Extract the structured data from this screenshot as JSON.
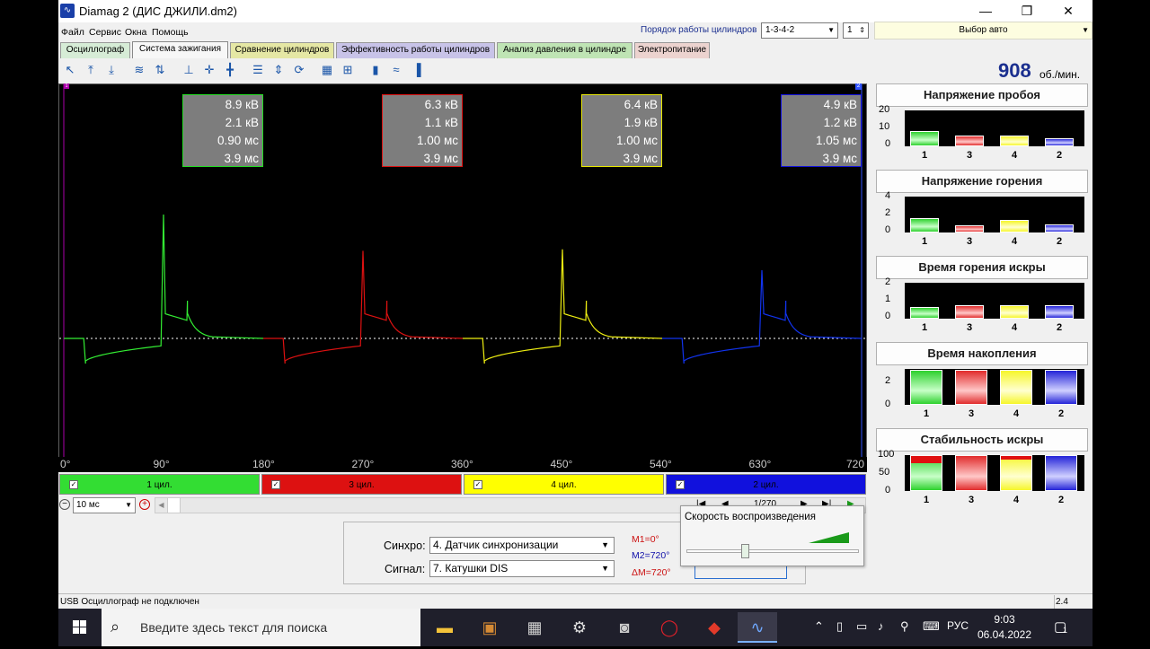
{
  "window": {
    "title": "Diamag 2 (ДИС ДЖИЛИ.dm2)",
    "min": "—",
    "max": "❐",
    "close": "✕"
  },
  "menu": [
    "Файл",
    "Сервис",
    "Окна",
    "Помощь"
  ],
  "header": {
    "order_label": "Порядок работы цилиндров",
    "order_value": "1-3-4-2",
    "cyl_count": "1",
    "auto_select": "Выбор авто"
  },
  "tabs": [
    {
      "label": "Осциллограф",
      "color": "#d6ecd6",
      "active": false
    },
    {
      "label": "Система зажигания",
      "color": "#f7f7f7",
      "active": true
    },
    {
      "label": "Сравнение цилиндров",
      "color": "#e5e7a4",
      "active": false
    },
    {
      "label": "Эффективность работы цилиндров",
      "color": "#c8c3e8",
      "active": false
    },
    {
      "label": "Анализ давления в цилиндре",
      "color": "#bfe4b4",
      "active": false
    },
    {
      "label": "Электропитание",
      "color": "#ecd3cf",
      "active": false
    }
  ],
  "rpm": {
    "value": "908",
    "unit": "об./мин."
  },
  "readouts": [
    {
      "values": [
        "8.9 кВ",
        "2.1 кВ",
        "0.90 мс",
        "3.9 мс"
      ],
      "color": "#22dd22"
    },
    {
      "values": [
        "6.3 кВ",
        "1.1 кВ",
        "1.00 мс",
        "3.9 мс"
      ],
      "color": "#dd1111"
    },
    {
      "values": [
        "6.4 кВ",
        "1.9 кВ",
        "1.00 мс",
        "3.9 мс"
      ],
      "color": "#e8e800"
    },
    {
      "values": [
        "4.9 кВ",
        "1.2 кВ",
        "1.05 мс",
        "3.9 мс"
      ],
      "color": "#1111dd"
    }
  ],
  "marker_left": "1",
  "marker_right": "2",
  "xaxis": [
    "0°",
    "90°",
    "180°",
    "270°",
    "360°",
    "450°",
    "540°",
    "630°",
    "720"
  ],
  "cylinders": [
    {
      "label": "1 цил.",
      "color": "#33dd33"
    },
    {
      "label": "3 цил.",
      "color": "#dd1111"
    },
    {
      "label": "4 цил.",
      "color": "#ffff00"
    },
    {
      "label": "2 цил.",
      "color": "#1111dd"
    }
  ],
  "timebase": "10 мс",
  "nav": {
    "page": "1/270"
  },
  "speed_popup": {
    "label": "Скорость воспроизведения",
    "level": 0.35
  },
  "sync": {
    "sync_label": "Синхро:",
    "sync_value": "4. Датчик синхронизации",
    "signal_label": "Сигнал:",
    "signal_value": "7. Катушки DIS",
    "m1": "M1=0°",
    "m2": "M2=720°",
    "dm": "ΔM=720°"
  },
  "status": {
    "text": "USB Осциллограф не подключен",
    "version": "2.4"
  },
  "panels": [
    {
      "title": "Напряжение пробоя",
      "ticks": [
        "20",
        "10",
        "0"
      ],
      "max": 20,
      "values": [
        8.9,
        6.3,
        6.4,
        4.9
      ],
      "cats": [
        "1",
        "3",
        "4",
        "2"
      ],
      "style": "small"
    },
    {
      "title": "Напряжение горения",
      "ticks": [
        "4",
        "2",
        "0"
      ],
      "max": 5,
      "values": [
        2.1,
        1.1,
        1.9,
        1.2
      ],
      "cats": [
        "1",
        "3",
        "4",
        "2"
      ],
      "style": "small"
    },
    {
      "title": "Время горения искры",
      "ticks": [
        "2",
        "1",
        "0"
      ],
      "max": 2.6,
      "values": [
        0.9,
        1.0,
        1.0,
        1.05
      ],
      "cats": [
        "1",
        "3",
        "4",
        "2"
      ],
      "style": "small"
    },
    {
      "title": "Время накопления",
      "ticks": [
        "2",
        "0"
      ],
      "max": 4,
      "values": [
        3.9,
        3.9,
        3.9,
        3.9
      ],
      "cats": [
        "1",
        "3",
        "4",
        "2"
      ],
      "style": "full"
    },
    {
      "title": "Стабильность искры",
      "ticks": [
        "100",
        "50",
        "0"
      ],
      "max": 100,
      "values": [
        100,
        100,
        100,
        100
      ],
      "unstable": [
        20,
        0,
        10,
        0
      ],
      "cats": [
        "1",
        "3",
        "4",
        "2"
      ],
      "style": "stab"
    }
  ],
  "taskbar": {
    "search_placeholder": "Введите здесь текст для поиска",
    "lang": "РУС",
    "time": "9:03",
    "date": "06.04.2022",
    "notif_count": "1"
  }
}
